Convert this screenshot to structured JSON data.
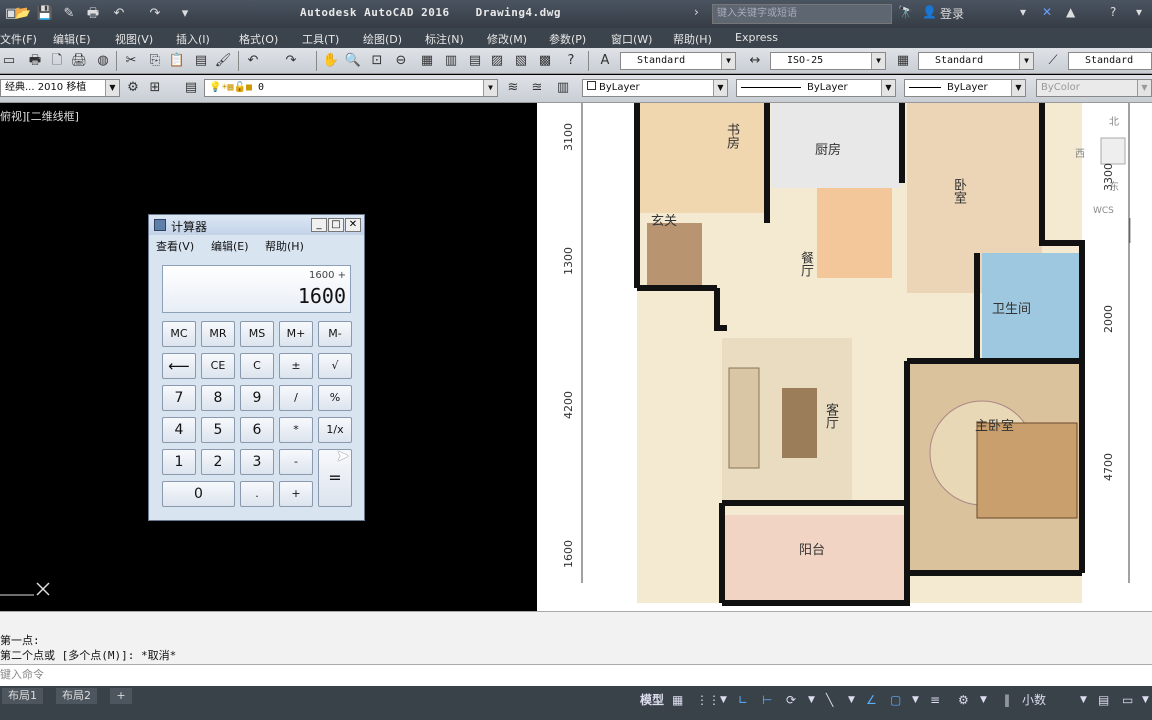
{
  "window": {
    "app_title": "Autodesk AutoCAD 2016",
    "file_name": "Drawing4.dwg",
    "search_placeholder": "键入关键字或短语",
    "login_label": "登录"
  },
  "menu": [
    "文件(F)",
    "编辑(E)",
    "视图(V)",
    "插入(I)",
    "格式(O)",
    "工具(T)",
    "绘图(D)",
    "标注(N)",
    "修改(M)",
    "参数(P)",
    "窗口(W)",
    "帮助(H)",
    "Express"
  ],
  "toolbar1": {
    "text_style": "Standard",
    "dim_style": "ISO-25",
    "table_style": "Standard",
    "multileader_style": "Standard"
  },
  "toolbar2": {
    "workspace": "经典... 2010 移植",
    "layer": "0",
    "color": "ByLayer",
    "linetype": "ByLayer",
    "lineweight": "ByLayer",
    "plotstyle": "ByColor"
  },
  "viewport": {
    "label": "俯视][二维线框]",
    "wcs_label": "WCS",
    "compass": {
      "north": "北",
      "west": "西",
      "east": "东"
    }
  },
  "floorplan": {
    "rooms": [
      "书房",
      "厨房",
      "卧室",
      "玄关",
      "餐厅",
      "卫生间",
      "客厅",
      "主卧室",
      "阳台"
    ],
    "dims_left": [
      "3100",
      "1300",
      "4200",
      "1600"
    ],
    "dims_right": [
      "3300",
      "2000",
      "4700"
    ]
  },
  "calculator": {
    "title": "计算器",
    "menu": [
      "查看(V)",
      "编辑(E)",
      "帮助(H)"
    ],
    "history": "1600 +",
    "value": "1600",
    "buttons": {
      "mc": "MC",
      "mr": "MR",
      "ms": "MS",
      "mplus": "M+",
      "mminus": "M-",
      "back": "⟵",
      "ce": "CE",
      "c": "C",
      "pm": "±",
      "sqrt": "√",
      "n7": "7",
      "n8": "8",
      "n9": "9",
      "div": "/",
      "pct": "%",
      "n4": "4",
      "n5": "5",
      "n6": "6",
      "mul": "*",
      "inv": "1/x",
      "n1": "1",
      "n2": "2",
      "n3": "3",
      "sub": "-",
      "eq": "=",
      "n0": "0",
      "dot": ".",
      "add": "+"
    }
  },
  "command": {
    "line1": "第一点:",
    "line2": "第二个点或 [多个点(M)]: *取消*",
    "input_placeholder": "键入命令"
  },
  "status": {
    "tabs": [
      "布局1",
      "布局2"
    ],
    "model_label": "模型",
    "units": "小数"
  }
}
